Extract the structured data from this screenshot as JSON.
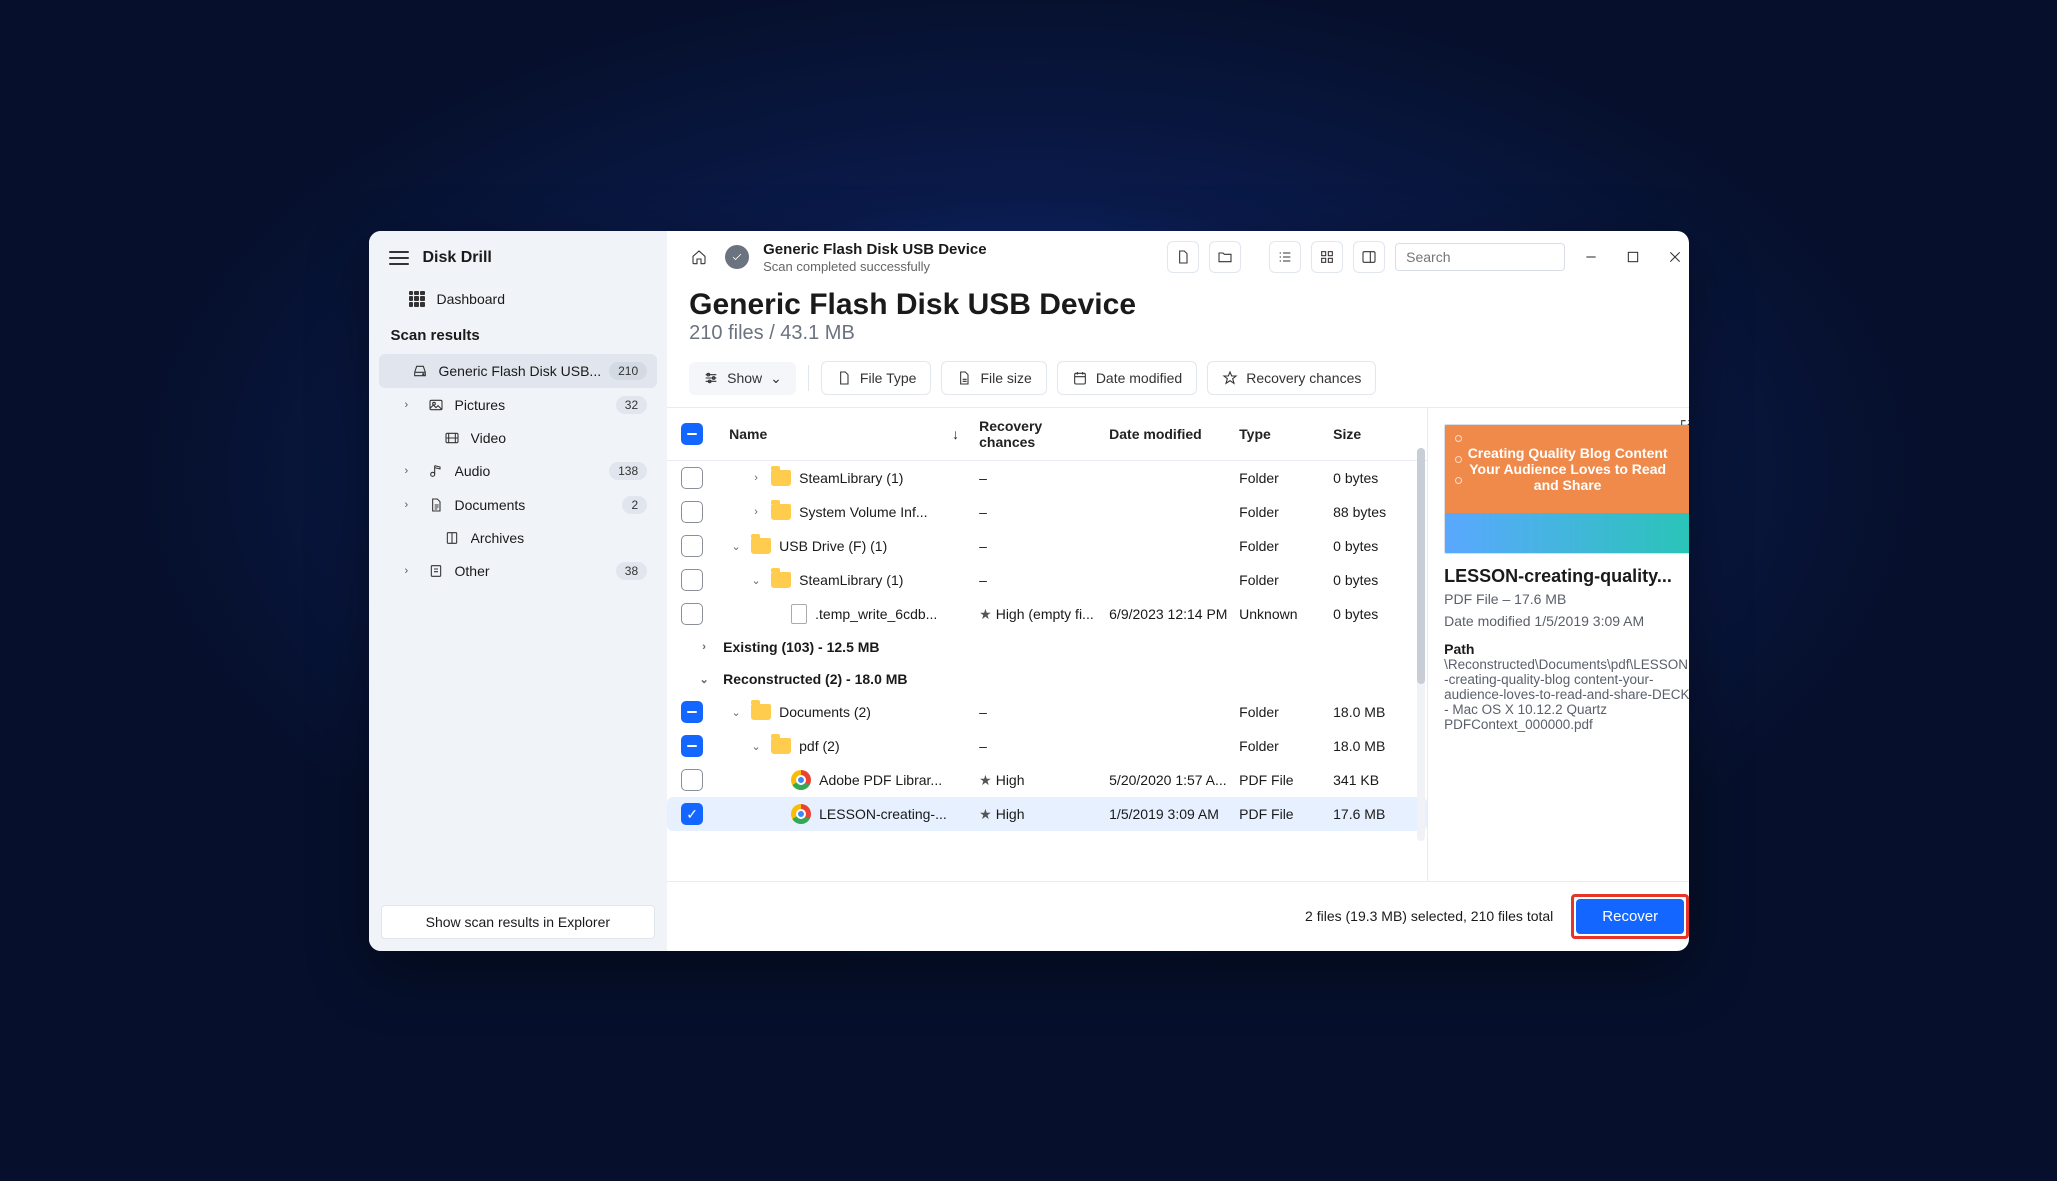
{
  "app": {
    "title": "Disk Drill"
  },
  "sidebar": {
    "dashboard": "Dashboard",
    "scan_results_heading": "Scan results",
    "items": [
      {
        "label": "Generic Flash Disk USB...",
        "count": "210",
        "icon": "drive",
        "selected": true,
        "indent": 0,
        "chev": ""
      },
      {
        "label": "Pictures",
        "count": "32",
        "icon": "image",
        "indent": 1,
        "chev": "›"
      },
      {
        "label": "Video",
        "count": "",
        "icon": "video",
        "indent": 2,
        "chev": ""
      },
      {
        "label": "Audio",
        "count": "138",
        "icon": "audio",
        "indent": 1,
        "chev": "›"
      },
      {
        "label": "Documents",
        "count": "2",
        "icon": "doc",
        "indent": 1,
        "chev": "›"
      },
      {
        "label": "Archives",
        "count": "",
        "icon": "archive",
        "indent": 2,
        "chev": ""
      },
      {
        "label": "Other",
        "count": "38",
        "icon": "other",
        "indent": 1,
        "chev": "›"
      }
    ],
    "footer_btn": "Show scan results in Explorer"
  },
  "topbar": {
    "title": "Generic Flash Disk USB Device",
    "subtitle": "Scan completed successfully",
    "search_placeholder": "Search"
  },
  "header": {
    "title": "Generic Flash Disk USB Device",
    "summary": "210 files / 43.1 MB"
  },
  "filters": {
    "show": "Show",
    "file_type": "File Type",
    "file_size": "File size",
    "date_modified": "Date modified",
    "recovery_chances": "Recovery chances"
  },
  "columns": {
    "name": "Name",
    "recovery": "Recovery chances",
    "date": "Date modified",
    "type": "Type",
    "size": "Size"
  },
  "rows": [
    {
      "cb": "",
      "chev": "›",
      "indent": 1,
      "icon": "folder",
      "name": "SteamLibrary (1)",
      "rec": "–",
      "date": "",
      "type": "Folder",
      "size": "0 bytes"
    },
    {
      "cb": "",
      "chev": "›",
      "indent": 1,
      "icon": "folder",
      "name": "System Volume Inf...",
      "rec": "–",
      "date": "",
      "type": "Folder",
      "size": "88 bytes"
    },
    {
      "cb": "",
      "chev": "⌄",
      "indent": 0,
      "icon": "folder",
      "name": "USB Drive (F) (1)",
      "rec": "–",
      "date": "",
      "type": "Folder",
      "size": "0 bytes"
    },
    {
      "cb": "",
      "chev": "⌄",
      "indent": 1,
      "icon": "folder",
      "name": "SteamLibrary (1)",
      "rec": "–",
      "date": "",
      "type": "Folder",
      "size": "0 bytes"
    },
    {
      "cb": "",
      "chev": "",
      "indent": 2,
      "icon": "file",
      "name": ".temp_write_6cdb...",
      "rec": "★High (empty fi...",
      "date": "6/9/2023 12:14 PM",
      "type": "Unknown",
      "size": "0 bytes"
    }
  ],
  "groups": {
    "existing": "Existing (103) - 12.5 MB",
    "reconstructed": "Reconstructed (2) - 18.0 MB"
  },
  "rows2": [
    {
      "cb": "partial",
      "chev": "⌄",
      "indent": 0,
      "icon": "folder",
      "name": "Documents (2)",
      "rec": "–",
      "date": "",
      "type": "Folder",
      "size": "18.0 MB"
    },
    {
      "cb": "partial",
      "chev": "⌄",
      "indent": 1,
      "icon": "folder",
      "name": "pdf (2)",
      "rec": "–",
      "date": "",
      "type": "Folder",
      "size": "18.0 MB"
    },
    {
      "cb": "",
      "chev": "",
      "indent": 2,
      "icon": "chrome",
      "name": "Adobe PDF Librar...",
      "rec": "★High",
      "date": "5/20/2020 1:57 A...",
      "type": "PDF File",
      "size": "341 KB"
    },
    {
      "cb": "checked",
      "chev": "",
      "indent": 2,
      "icon": "chrome",
      "name": "LESSON-creating-...",
      "rec": "★High",
      "date": "1/5/2019 3:09 AM",
      "type": "PDF File",
      "size": "17.6 MB",
      "selected": true
    }
  ],
  "details": {
    "preview_text": "Creating Quality Blog Content Your Audience Loves to Read and Share",
    "title": "LESSON-creating-quality...",
    "meta": "PDF File – 17.6 MB",
    "date": "Date modified 1/5/2019 3:09 AM",
    "path_label": "Path",
    "path": "\\Reconstructed\\Documents\\pdf\\LESSON-creating-quality-blog content-your-audience-loves-to-read-and-share-DECK - Mac OS X 10.12.2 Quartz PDFContext_000000.pdf"
  },
  "footer": {
    "status": "2 files (19.3 MB) selected, 210 files total",
    "recover": "Recover"
  }
}
